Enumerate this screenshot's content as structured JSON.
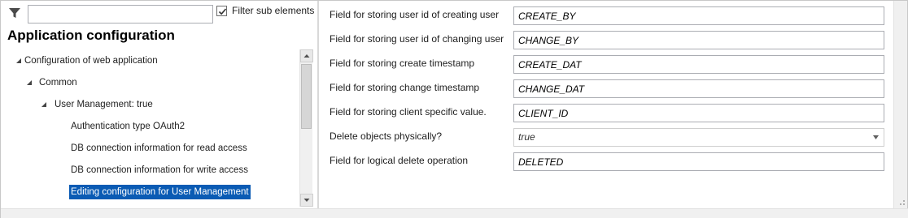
{
  "filter": {
    "placeholder": "",
    "value": "",
    "checkbox_label": "Filter sub elements",
    "checkbox_checked": true
  },
  "app_title": "Application configuration",
  "tree": {
    "items": [
      {
        "label": "Configuration of web application",
        "level": 0,
        "expanded": true,
        "selected": false
      },
      {
        "label": "Common",
        "level": 1,
        "expanded": true,
        "selected": false
      },
      {
        "label": "User Management: true",
        "level": 2,
        "expanded": true,
        "selected": false
      },
      {
        "label": "Authentication type OAuth2",
        "level": 3,
        "expanded": null,
        "selected": false
      },
      {
        "label": "DB connection information for read access",
        "level": 3,
        "expanded": null,
        "selected": false
      },
      {
        "label": "DB connection information for write access",
        "level": 3,
        "expanded": null,
        "selected": false
      },
      {
        "label": "Editing configuration for User Management",
        "level": 3,
        "expanded": null,
        "selected": true
      }
    ]
  },
  "fields": [
    {
      "label": "Field for storing user id of creating user",
      "value": "CREATE_BY",
      "type": "text"
    },
    {
      "label": "Field for storing user id of changing user",
      "value": "CHANGE_BY",
      "type": "text"
    },
    {
      "label": "Field for storing create timestamp",
      "value": "CREATE_DAT",
      "type": "text"
    },
    {
      "label": "Field for storing change timestamp",
      "value": "CHANGE_DAT",
      "type": "text"
    },
    {
      "label": "Field for storing client specific value.",
      "value": "CLIENT_ID",
      "type": "text"
    },
    {
      "label": "Delete objects physically?",
      "value": "true",
      "type": "select"
    },
    {
      "label": "Field for logical delete operation",
      "value": "DELETED",
      "type": "text"
    }
  ],
  "colors": {
    "selection": "#0a5bb4",
    "border": "#abadb3",
    "panel": "#f0f0f0"
  },
  "icons": {
    "filter": "funnel-icon",
    "tree_expanded": "triangle-expanded-icon",
    "scroll_up": "arrow-up-icon",
    "scroll_down": "arrow-down-icon",
    "dropdown": "chevron-down-icon"
  }
}
